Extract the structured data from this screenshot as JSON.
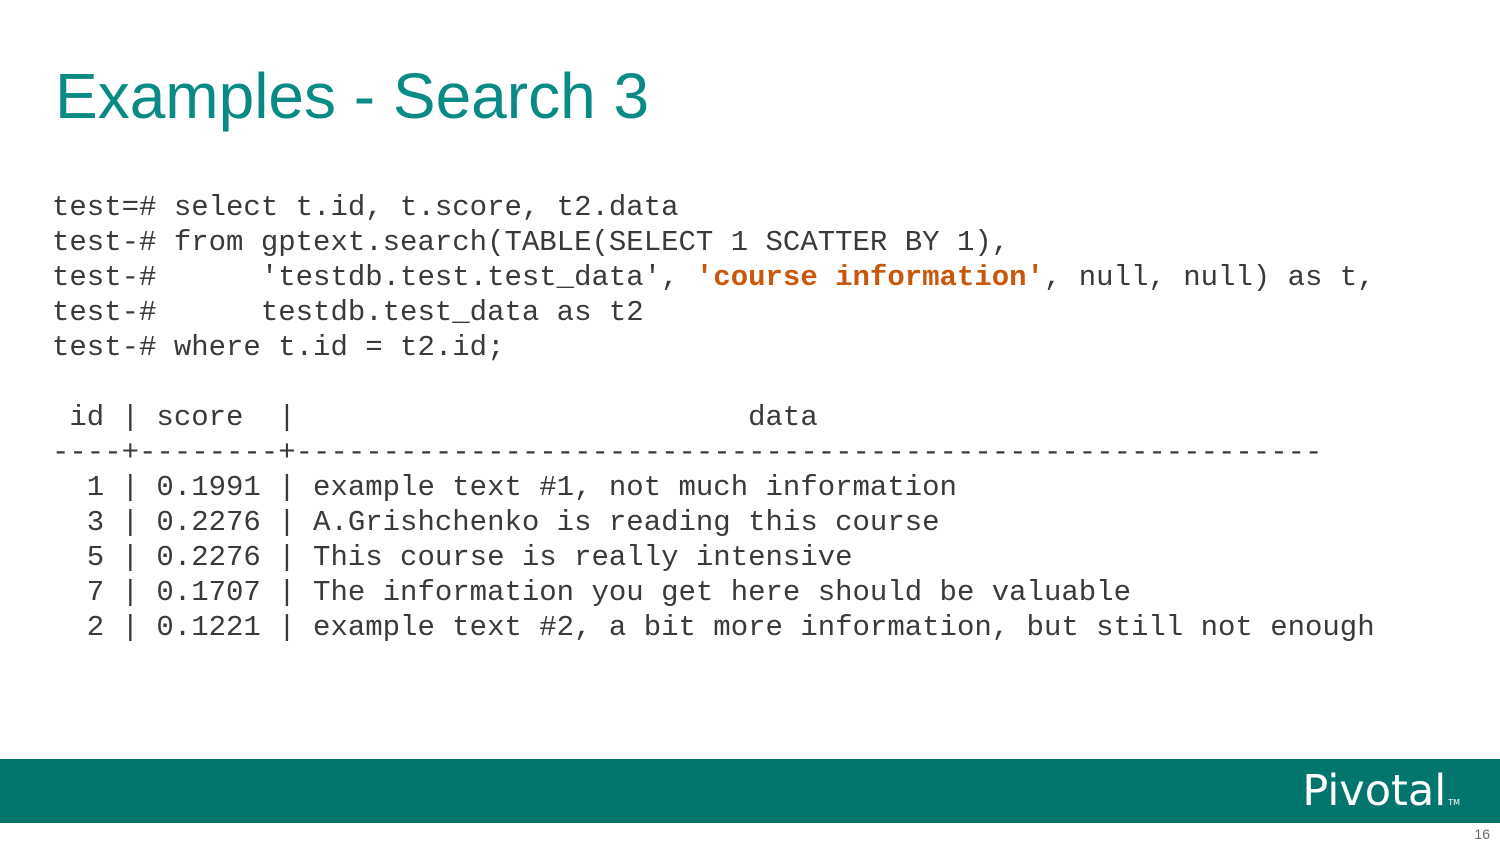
{
  "slide": {
    "title": "Examples - Search 3",
    "page_number": "16"
  },
  "code": {
    "line1": "test=# select t.id, t.score, t2.data",
    "line2": "test-# from gptext.search(TABLE(SELECT 1 SCATTER BY 1),",
    "line3_prefix": "test-#      'testdb.test.test_data', ",
    "line3_highlight": "'course information'",
    "line3_suffix": ", null, null) as t,",
    "line4": "test-#      testdb.test_data as t2",
    "line5": "test-# where t.id = t2.id;",
    "line6": "",
    "header": " id | score  |                          data",
    "separator": "----+--------+-----------------------------------------------------------",
    "rows": [
      "  1 | 0.1991 | example text #1, not much information",
      "  3 | 0.2276 | A.Grishchenko is reading this course",
      "  5 | 0.2276 | This course is really intensive",
      "  7 | 0.1707 | The information you get here should be valuable",
      "  2 | 0.1221 | example text #2, a bit more information, but still not enough"
    ],
    "highlight_color": "#c9580a"
  },
  "footer": {
    "logo_text": "Pivotal",
    "trademark": "TM",
    "bar_color": "#02766d"
  }
}
